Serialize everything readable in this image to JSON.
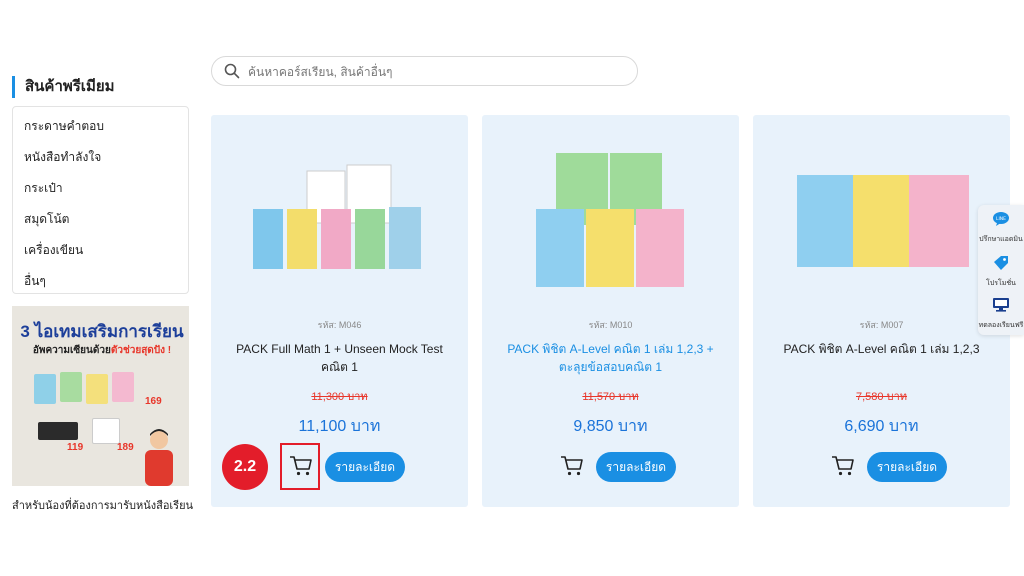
{
  "sidebar": {
    "title": "สินค้าพรีเมียม",
    "items": [
      {
        "label": "กระดาษคำตอบ"
      },
      {
        "label": "หนังสือทำลังใจ"
      },
      {
        "label": "กระเป๋า"
      },
      {
        "label": "สมุดโน้ต"
      },
      {
        "label": "เครื่องเขียน"
      },
      {
        "label": "อื่นๆ"
      }
    ],
    "promo": {
      "title": "3 ไอเทมเสริมการเรียน",
      "subtitle_prefix": "อัพความเซียนด้วย",
      "subtitle_highlight": "ตัวช่วยสุดปัง !",
      "prices": [
        "169",
        "119",
        "189"
      ]
    },
    "caption": "สำหรับน้องที่ต้องการมารับหนังสือเรียน"
  },
  "search": {
    "placeholder": "ค้นหาคอร์สเรียน, สินค้าอื่นๆ",
    "value": ""
  },
  "products": [
    {
      "code": "รหัส: M046",
      "name": "PACK Full Math 1 + Unseen Mock Test คณิต 1",
      "old_price": "11,300 บาท",
      "price": "11,100 บาท",
      "detail_label": "รายละเอียด",
      "highlighted": true
    },
    {
      "code": "รหัส: M010",
      "name": "PACK พิชิต A-Level คณิต 1 เล่ม 1,2,3 + ตะลุยข้อสอบคณิต 1",
      "old_price": "11,570 บาท",
      "price": "9,850 บาท",
      "detail_label": "รายละเอียด"
    },
    {
      "code": "รหัส: M007",
      "name": "PACK พิชิต A-Level คณิต 1 เล่ม 1,2,3",
      "old_price": "7,580 บาท",
      "price": "6,690 บาท",
      "detail_label": "รายละเอียด"
    }
  ],
  "annotation": {
    "step_label": "2.2",
    "color": "#e31d2a"
  },
  "float_panel": {
    "items": [
      {
        "icon": "line-chat-icon",
        "label": "ปรึกษาแอดมิน"
      },
      {
        "icon": "promotion-tag-icon",
        "label": "โปรโมชั่น"
      },
      {
        "icon": "trial-class-monitor-icon",
        "label": "ทดลองเรียนฟรี"
      }
    ]
  },
  "colors": {
    "accent": "#1a8fe3",
    "card_bg": "#e8f2fb",
    "strike_price": "#e8362a",
    "price": "#1a73d9"
  }
}
